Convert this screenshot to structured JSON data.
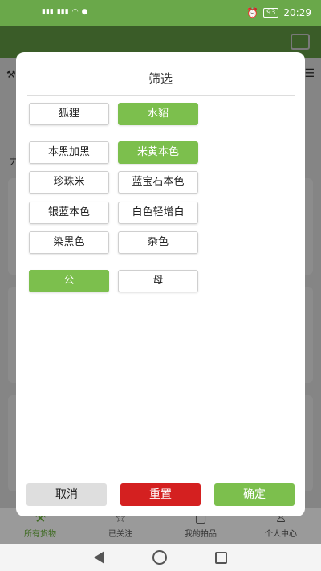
{
  "status": {
    "time": "20:29",
    "battery": "93"
  },
  "dialog": {
    "title": "筛选",
    "group1": [
      {
        "label": "狐狸",
        "selected": false
      },
      {
        "label": "水貂",
        "selected": true
      }
    ],
    "group2": [
      {
        "label": "本黑加黑",
        "selected": false
      },
      {
        "label": "米黄本色",
        "selected": true
      },
      {
        "label": "珍珠米",
        "selected": false
      },
      {
        "label": "蓝宝石本色",
        "selected": false
      },
      {
        "label": "银蓝本色",
        "selected": false
      },
      {
        "label": "白色轻增白",
        "selected": false
      },
      {
        "label": "染黑色",
        "selected": false
      },
      {
        "label": "杂色",
        "selected": false
      }
    ],
    "group3": [
      {
        "label": "公",
        "selected": true
      },
      {
        "label": "母",
        "selected": false
      }
    ],
    "cancel_label": "取消",
    "reset_label": "重置",
    "confirm_label": "确定"
  },
  "bottom_nav": [
    {
      "label": "所有货物",
      "icon": "gavel-icon",
      "active": true
    },
    {
      "label": "已关注",
      "icon": "star-icon",
      "active": false
    },
    {
      "label": "我的拍品",
      "icon": "box-icon",
      "active": false
    },
    {
      "label": "个人中心",
      "icon": "person-icon",
      "active": false
    }
  ],
  "background": {
    "side_char": "力"
  },
  "colors": {
    "accent": "#7cbf4d",
    "reset": "#d42020",
    "header": "#6aa84a"
  }
}
